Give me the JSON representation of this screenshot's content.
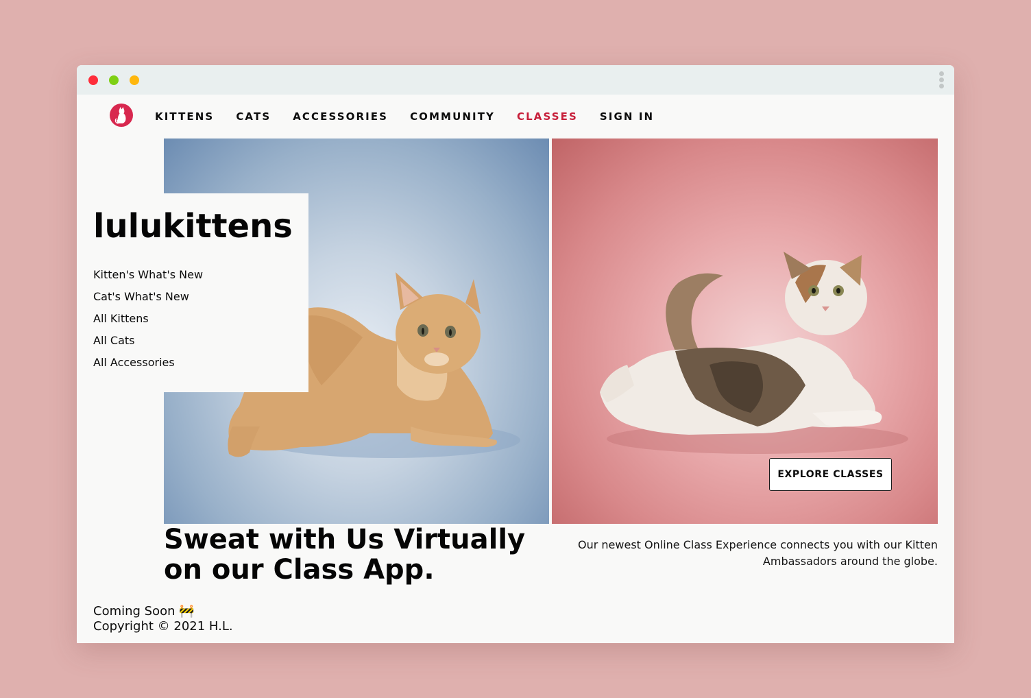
{
  "nav": {
    "items": [
      {
        "label": "KITTENS",
        "active": false
      },
      {
        "label": "CATS",
        "active": false
      },
      {
        "label": "ACCESSORIES",
        "active": false
      },
      {
        "label": "COMMUNITY",
        "active": false
      },
      {
        "label": "CLASSES",
        "active": true
      },
      {
        "label": "SIGN IN",
        "active": false
      }
    ]
  },
  "brand": {
    "name": "lulukittens",
    "links": [
      "Kitten's What's New",
      "Cat's What's New",
      "All Kittens",
      "All Cats",
      "All Accessories"
    ]
  },
  "hero": {
    "cta_label": "EXPLORE CLASSES",
    "headline": "Sweat with Us Virtually on our Class App.",
    "subcopy": "Our newest Online Class Experience connects you with our Kitten Ambassadors around the globe."
  },
  "footer": {
    "coming_soon": "Coming Soon 🚧",
    "copyright": "Copyright © 2021 H.L."
  },
  "colors": {
    "page_background": "#dfb0ae",
    "accent": "#c71f3a",
    "logo": "#d8284f",
    "left_photo_tone": "#98b0c9",
    "right_photo_tone": "#e8a8aa"
  },
  "icons": {
    "logo": "cat-silhouette-icon",
    "window_menu": "kebab-menu-icon"
  }
}
